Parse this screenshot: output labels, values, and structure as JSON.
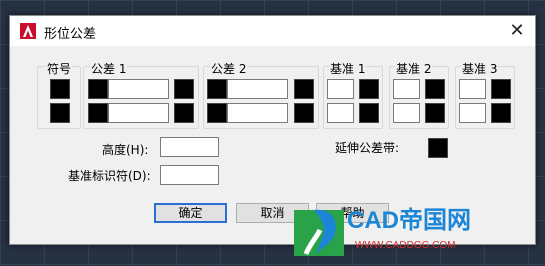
{
  "dialog": {
    "title": "形位公差",
    "app_icon": "autocad-logo-icon",
    "close_icon": "✕"
  },
  "headers": {
    "symbol": "符号",
    "tol1": "公差 1",
    "tol2": "公差 2",
    "datum1": "基准 1",
    "datum2": "基准 2",
    "datum3": "基准 3"
  },
  "fields": {
    "height_label": "高度(H):",
    "height_value": "",
    "datum_id_label": "基准标识符(D):",
    "datum_id_value": "",
    "projected_zone_label": "延伸公差带:"
  },
  "buttons": {
    "ok": "确定",
    "cancel": "取消",
    "help": "帮助"
  },
  "watermark": {
    "brand": "CAD帝国网",
    "url": "WWW.CADDGG.COM"
  },
  "colors": {
    "desktop": "#263142",
    "dialog_bg": "#f0f0f0",
    "default_button_border": "#2c6fd1",
    "watermark_blue": "#1c86d6",
    "watermark_red": "#d03030"
  }
}
